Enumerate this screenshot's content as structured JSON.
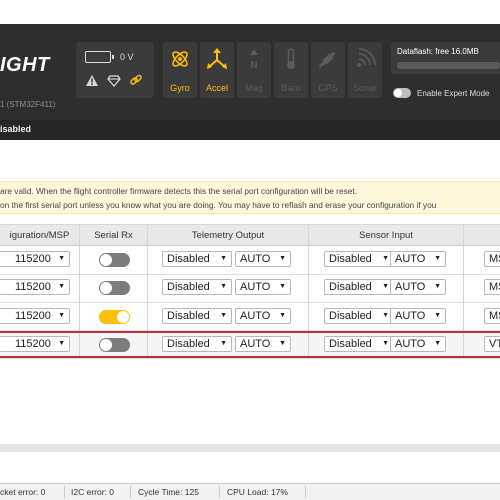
{
  "header": {
    "logo_text": "IGHT",
    "firmware_info": "1 (STM32F411)",
    "voltage": "0 V",
    "dataflash_label": "Dataflash: free 16.0MB",
    "expert_mode_label": "Enable Expert Mode",
    "arming_status": "isabled",
    "sensors": [
      {
        "label": "Gyro",
        "icon": "gyro-icon",
        "active": true
      },
      {
        "label": "Accel",
        "icon": "accel-icon",
        "active": true
      },
      {
        "label": "Mag",
        "icon": "mag-icon",
        "active": false
      },
      {
        "label": "Baro",
        "icon": "baro-icon",
        "active": false
      },
      {
        "label": "GPS",
        "icon": "gps-icon",
        "active": false
      },
      {
        "label": "Sonar",
        "icon": "sonar-icon",
        "active": false
      }
    ],
    "colors": {
      "accent": "#ffbe0b",
      "header_bg": "#2e2e2e",
      "inactive": "#5c5c5c"
    }
  },
  "notes": {
    "line1": "are valid. When the flight controller firmware detects this the serial port configuration will be reset.",
    "line2": "on the first serial port unless you know what you are doing. You may have to reflash and erase your configuration if you"
  },
  "table": {
    "columns": {
      "config_msp": "iguration/MSP",
      "serial_rx": "Serial Rx",
      "telemetry": "Telemetry Output",
      "sensor": "Sensor Input"
    },
    "rows": [
      {
        "baud": "115200",
        "serial_rx": false,
        "tele_mode": "Disabled",
        "tele_baud": "AUTO",
        "sensor_mode": "Disabled",
        "sensor_baud": "AUTO",
        "ext": "MS"
      },
      {
        "baud": "115200",
        "serial_rx": false,
        "tele_mode": "Disabled",
        "tele_baud": "AUTO",
        "sensor_mode": "Disabled",
        "sensor_baud": "AUTO",
        "ext": "MS"
      },
      {
        "baud": "115200",
        "serial_rx": true,
        "tele_mode": "Disabled",
        "tele_baud": "AUTO",
        "sensor_mode": "Disabled",
        "sensor_baud": "AUTO",
        "ext": "MS"
      },
      {
        "baud": "115200",
        "serial_rx": false,
        "tele_mode": "Disabled",
        "tele_baud": "AUTO",
        "sensor_mode": "Disabled",
        "sensor_baud": "AUTO",
        "ext": "VT"
      }
    ]
  },
  "statusbar": {
    "packet_error": "cket error: 0",
    "i2c_error": "I2C error: 0",
    "cycle_time": "Cycle Time: 125",
    "cpu_load": "CPU Load: 17%"
  }
}
